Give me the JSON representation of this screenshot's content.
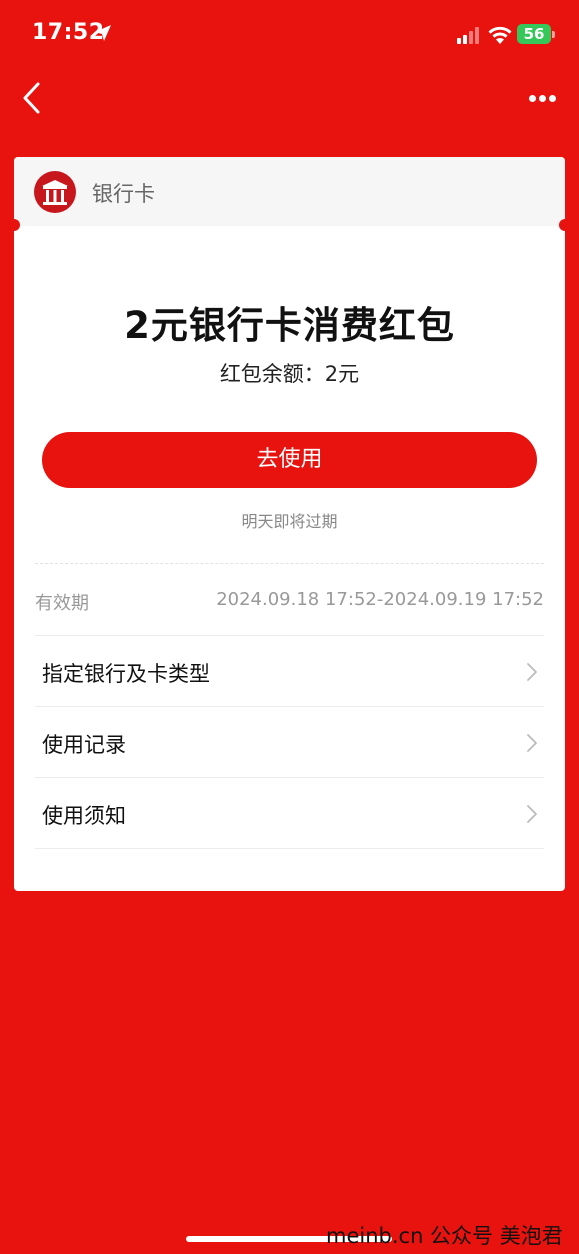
{
  "status_bar": {
    "time": "17:52",
    "battery": "56"
  },
  "nav": {
    "back_icon": "chevron-left-icon",
    "more_icon": "ellipsis-icon"
  },
  "card": {
    "header_title": "银行卡",
    "logo_icon": "bank-building-icon",
    "coupon_title": "2元银行卡消费红包",
    "balance": "红包余额：2元",
    "use_button_label": "去使用",
    "expire_hint": "明天即将过期",
    "validity_label": "有效期",
    "validity_value": "2024.09.18 17:52-2024.09.19 17:52",
    "rows": [
      {
        "label": "指定银行及卡类型"
      },
      {
        "label": "使用记录"
      },
      {
        "label": "使用须知"
      }
    ]
  },
  "watermark": "meinb.cn  公众号 美泡君",
  "colors": {
    "brand_red": "#E8120F",
    "battery_green": "#35C759"
  }
}
